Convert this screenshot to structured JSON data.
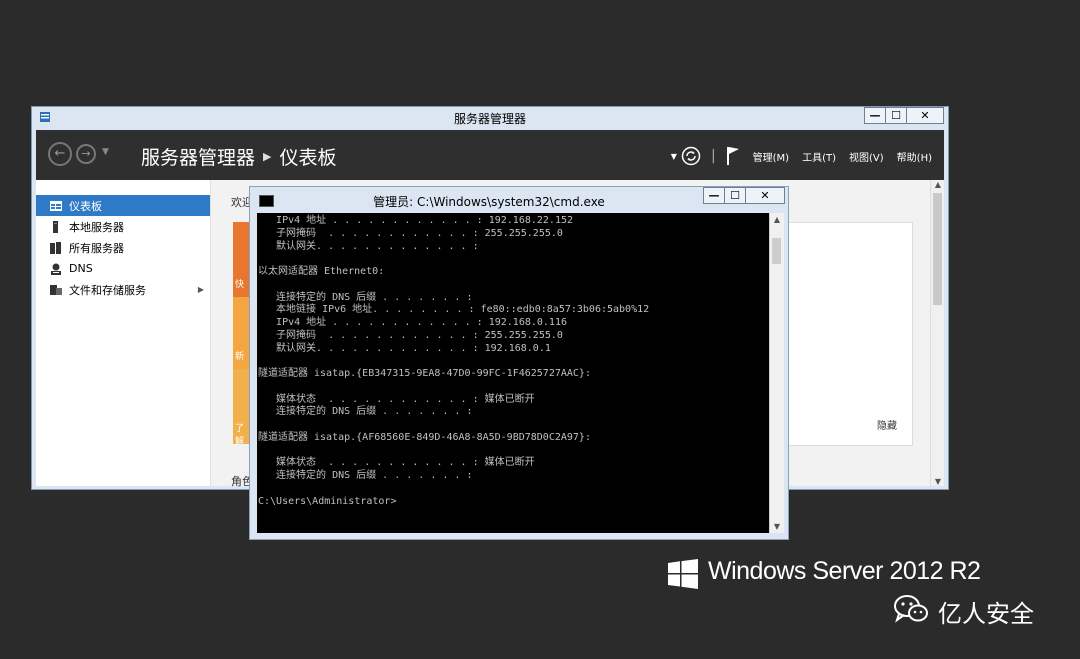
{
  "server_manager": {
    "window_title": "服务器管理器",
    "breadcrumb": {
      "root": "服务器管理器",
      "current": "仪表板"
    },
    "menus": [
      {
        "label": "管理(M)"
      },
      {
        "label": "工具(T)"
      },
      {
        "label": "视图(V)"
      },
      {
        "label": "帮助(H)"
      }
    ],
    "nav_items": [
      {
        "label": "仪表板",
        "icon": "dashboard-icon",
        "selected": true
      },
      {
        "label": "本地服务器",
        "icon": "local-server-icon"
      },
      {
        "label": "所有服务器",
        "icon": "all-servers-icon"
      },
      {
        "label": "DNS",
        "icon": "dns-icon"
      },
      {
        "label": "文件和存储服务",
        "icon": "file-storage-icon",
        "has_submenu": true
      }
    ],
    "content": {
      "welcome_label": "欢迎",
      "tile_labels": [
        "快",
        "新",
        "了解"
      ],
      "hide_link": "隐藏",
      "roles_label": "角色"
    },
    "window_buttons": {
      "minimize": "—",
      "maximize": "☐",
      "close": "✕"
    }
  },
  "cmd": {
    "window_title": "管理员: C:\\Windows\\system32\\cmd.exe",
    "lines": [
      "   IPv4 地址 . . . . . . . . . . . . : 192.168.22.152",
      "   子网掩码  . . . . . . . . . . . . : 255.255.255.0",
      "   默认网关. . . . . . . . . . . . . :",
      "",
      "以太网适配器 Ethernet0:",
      "",
      "   连接特定的 DNS 后缀 . . . . . . . :",
      "   本地链接 IPv6 地址. . . . . . . . : fe80::edb0:8a57:3b06:5ab0%12",
      "   IPv4 地址 . . . . . . . . . . . . : 192.168.0.116",
      "   子网掩码  . . . . . . . . . . . . : 255.255.255.0",
      "   默认网关. . . . . . . . . . . . . : 192.168.0.1",
      "",
      "隧道适配器 isatap.{EB347315-9EA8-47D0-99FC-1F4625727AAC}:",
      "",
      "   媒体状态  . . . . . . . . . . . . : 媒体已断开",
      "   连接特定的 DNS 后缀 . . . . . . . :",
      "",
      "隧道适配器 isatap.{AF68560E-849D-46A8-8A5D-9BD78D0C2A97}:",
      "",
      "   媒体状态  . . . . . . . . . . . . : 媒体已断开",
      "   连接特定的 DNS 后缀 . . . . . . . :",
      "",
      "C:\\Users\\Administrator>"
    ],
    "window_buttons": {
      "minimize": "—",
      "maximize": "☐",
      "close": "✕"
    }
  },
  "branding": {
    "os_name": "Windows Server 2012 R2",
    "account_name": "亿人安全"
  },
  "colors": {
    "background": "#2b2b2b",
    "header": "#2f2f2f",
    "selected": "#2e7ac7",
    "tile_orange": "#f0a03c",
    "console_bg": "#000000",
    "console_text": "#c0c0c0"
  }
}
